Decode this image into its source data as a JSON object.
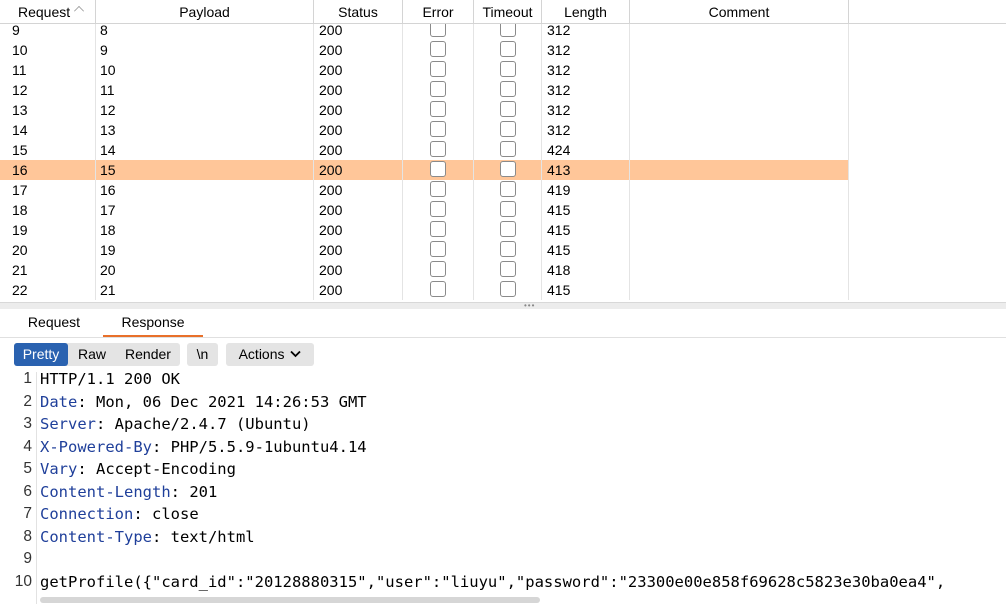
{
  "table": {
    "columns": {
      "request": "Request",
      "payload": "Payload",
      "status": "Status",
      "error": "Error",
      "timeout": "Timeout",
      "length": "Length",
      "comment": "Comment"
    },
    "rows": [
      {
        "request": "9",
        "payload": "8",
        "status": "200",
        "length": "312",
        "selected": false
      },
      {
        "request": "10",
        "payload": "9",
        "status": "200",
        "length": "312",
        "selected": false
      },
      {
        "request": "11",
        "payload": "10",
        "status": "200",
        "length": "312",
        "selected": false
      },
      {
        "request": "12",
        "payload": "11",
        "status": "200",
        "length": "312",
        "selected": false
      },
      {
        "request": "13",
        "payload": "12",
        "status": "200",
        "length": "312",
        "selected": false
      },
      {
        "request": "14",
        "payload": "13",
        "status": "200",
        "length": "312",
        "selected": false
      },
      {
        "request": "15",
        "payload": "14",
        "status": "200",
        "length": "424",
        "selected": false
      },
      {
        "request": "16",
        "payload": "15",
        "status": "200",
        "length": "413",
        "selected": true
      },
      {
        "request": "17",
        "payload": "16",
        "status": "200",
        "length": "419",
        "selected": false
      },
      {
        "request": "18",
        "payload": "17",
        "status": "200",
        "length": "415",
        "selected": false
      },
      {
        "request": "19",
        "payload": "18",
        "status": "200",
        "length": "415",
        "selected": false
      },
      {
        "request": "20",
        "payload": "19",
        "status": "200",
        "length": "415",
        "selected": false
      },
      {
        "request": "21",
        "payload": "20",
        "status": "200",
        "length": "418",
        "selected": false
      },
      {
        "request": "22",
        "payload": "21",
        "status": "200",
        "length": "415",
        "selected": false
      }
    ]
  },
  "tabs": {
    "request": "Request",
    "response": "Response",
    "active": "Response"
  },
  "toolbar": {
    "pretty": "Pretty",
    "raw": "Raw",
    "render": "Render",
    "newline": "\\n",
    "actions": "Actions"
  },
  "code": [
    {
      "n": "1",
      "key": "",
      "val": "HTTP/1.1 200 OK"
    },
    {
      "n": "2",
      "key": "Date",
      "val": ": Mon, 06 Dec 2021 14:26:53 GMT"
    },
    {
      "n": "3",
      "key": "Server",
      "val": ": Apache/2.4.7 (Ubuntu)"
    },
    {
      "n": "4",
      "key": "X-Powered-By",
      "val": ": PHP/5.5.9-1ubuntu4.14"
    },
    {
      "n": "5",
      "key": "Vary",
      "val": ": Accept-Encoding"
    },
    {
      "n": "6",
      "key": "Content-Length",
      "val": ": 201"
    },
    {
      "n": "7",
      "key": "Connection",
      "val": ": close"
    },
    {
      "n": "8",
      "key": "Content-Type",
      "val": ": text/html"
    },
    {
      "n": "9",
      "key": "",
      "val": ""
    },
    {
      "n": "10",
      "key": "",
      "val": "getProfile({\"card_id\":\"20128880315\",\"user\":\"liuyu\",\"password\":\"23300e00e858f69628c5823e30ba0ea4\","
    }
  ],
  "colors": {
    "selected_row": "#ffc699",
    "accent_tab": "#e8702a",
    "pretty_active": "#2a62b0",
    "header_key": "#1f3f9a"
  }
}
